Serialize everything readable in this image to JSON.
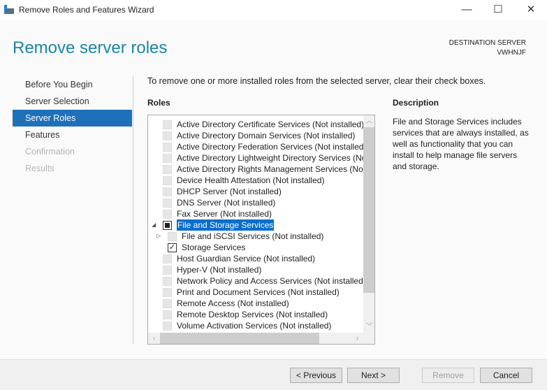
{
  "window": {
    "title": "Remove Roles and Features Wizard",
    "minimize": "—",
    "maximize": "☐",
    "close": "✕"
  },
  "header": {
    "title": "Remove server roles",
    "dest_label": "DESTINATION SERVER",
    "dest_server": "VWHNJF"
  },
  "sidebar": {
    "items": [
      {
        "label": "Before You Begin",
        "state": "normal"
      },
      {
        "label": "Server Selection",
        "state": "normal"
      },
      {
        "label": "Server Roles",
        "state": "selected"
      },
      {
        "label": "Features",
        "state": "normal"
      },
      {
        "label": "Confirmation",
        "state": "disabled"
      },
      {
        "label": "Results",
        "state": "disabled"
      }
    ]
  },
  "main": {
    "intro": "To remove one or more installed roles from the selected server, clear their check boxes.",
    "roles_heading": "Roles",
    "roles": [
      {
        "label": "Active Directory Certificate Services (Not installed)",
        "level": 0,
        "check": "disabled"
      },
      {
        "label": "Active Directory Domain Services (Not installed)",
        "level": 0,
        "check": "disabled"
      },
      {
        "label": "Active Directory Federation Services (Not installed)",
        "level": 0,
        "check": "disabled"
      },
      {
        "label": "Active Directory Lightweight Directory Services (Not installed)",
        "level": 0,
        "check": "disabled"
      },
      {
        "label": "Active Directory Rights Management Services (Not installed)",
        "level": 0,
        "check": "disabled"
      },
      {
        "label": "Device Health Attestation (Not installed)",
        "level": 0,
        "check": "disabled"
      },
      {
        "label": "DHCP Server (Not installed)",
        "level": 0,
        "check": "disabled"
      },
      {
        "label": "DNS Server (Not installed)",
        "level": 0,
        "check": "disabled"
      },
      {
        "label": "Fax Server (Not installed)",
        "level": 0,
        "check": "disabled"
      },
      {
        "label": "File and Storage Services",
        "level": 0,
        "check": "indeterminate",
        "expanded": true,
        "selected": true
      },
      {
        "label": "File and iSCSI Services (Not installed)",
        "level": 1,
        "check": "disabled",
        "expanded": false
      },
      {
        "label": "Storage Services",
        "level": 1,
        "check": "checked"
      },
      {
        "label": "Host Guardian Service (Not installed)",
        "level": 0,
        "check": "disabled"
      },
      {
        "label": "Hyper-V (Not installed)",
        "level": 0,
        "check": "disabled"
      },
      {
        "label": "Network Policy and Access Services (Not installed)",
        "level": 0,
        "check": "disabled"
      },
      {
        "label": "Print and Document Services (Not installed)",
        "level": 0,
        "check": "disabled"
      },
      {
        "label": "Remote Access (Not installed)",
        "level": 0,
        "check": "disabled"
      },
      {
        "label": "Remote Desktop Services (Not installed)",
        "level": 0,
        "check": "disabled"
      },
      {
        "label": "Volume Activation Services (Not installed)",
        "level": 0,
        "check": "disabled"
      }
    ],
    "description_heading": "Description",
    "description": "File and Storage Services includes services that are always installed, as well as functionality that you can install to help manage file servers and storage."
  },
  "footer": {
    "previous": "< Previous",
    "next": "Next >",
    "remove": "Remove",
    "cancel": "Cancel"
  },
  "colors": {
    "accent": "#1e70b8",
    "title": "#1b85a8",
    "selection": "#0a6ecc"
  }
}
